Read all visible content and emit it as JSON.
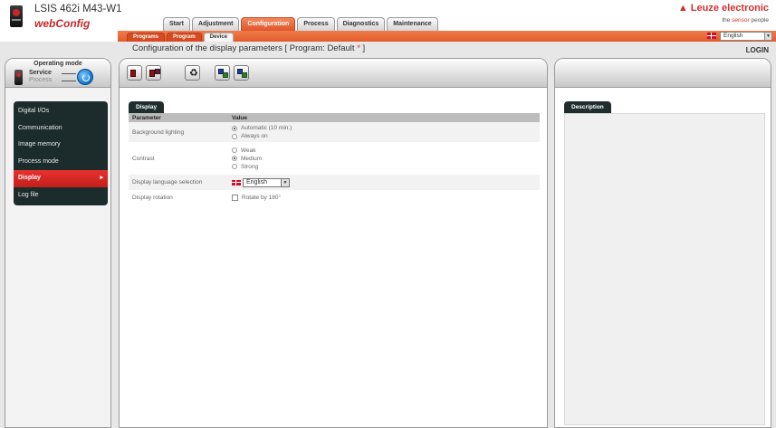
{
  "header": {
    "product_name": "LSIS 462i M43-W1",
    "app_name": "webConfig",
    "brand": "Leuze electronic",
    "tagline_prefix": "the ",
    "tagline_accent": "sensor",
    "tagline_suffix": " people"
  },
  "main_tabs": [
    {
      "label": "Start",
      "active": false
    },
    {
      "label": "Adjustment",
      "active": false
    },
    {
      "label": "Configuration",
      "active": true
    },
    {
      "label": "Process",
      "active": false
    },
    {
      "label": "Diagnostics",
      "active": false
    },
    {
      "label": "Maintenance",
      "active": false
    }
  ],
  "sub_tabs": [
    {
      "label": "Programs",
      "active": false
    },
    {
      "label": "Program",
      "active": false
    },
    {
      "label": "Device",
      "active": true
    }
  ],
  "language": {
    "selected": "English"
  },
  "title": {
    "text": "Configuration of the display parameters   [ Program: Default ",
    "star": "*",
    "close": " ]"
  },
  "login_label": "LOGIN",
  "operating_mode": {
    "title": "Operating mode",
    "service": "Service",
    "process": "Process"
  },
  "nav": [
    {
      "label": "Digital I/Os",
      "active": false
    },
    {
      "label": "Communication",
      "active": false
    },
    {
      "label": "Image memory",
      "active": false
    },
    {
      "label": "Process mode",
      "active": false
    },
    {
      "label": "Display",
      "active": true
    },
    {
      "label": "Log file",
      "active": false
    }
  ],
  "display_card": {
    "tab_label": "Display",
    "col_parameter": "Parameter",
    "col_value": "Value",
    "background_lighting": {
      "label": "Background lighting",
      "options": [
        "Automatic (10 min.)",
        "Always on"
      ],
      "selected": 0
    },
    "contrast": {
      "label": "Contrast",
      "options": [
        "Weak",
        "Medium",
        "Strong"
      ],
      "selected": 1
    },
    "language_selection": {
      "label": "Display language selection",
      "value": "English"
    },
    "rotation": {
      "label": "Display rotation",
      "checkbox_label": "Rotate by 180°",
      "checked": false
    }
  },
  "description": {
    "tab_label": "Description"
  }
}
